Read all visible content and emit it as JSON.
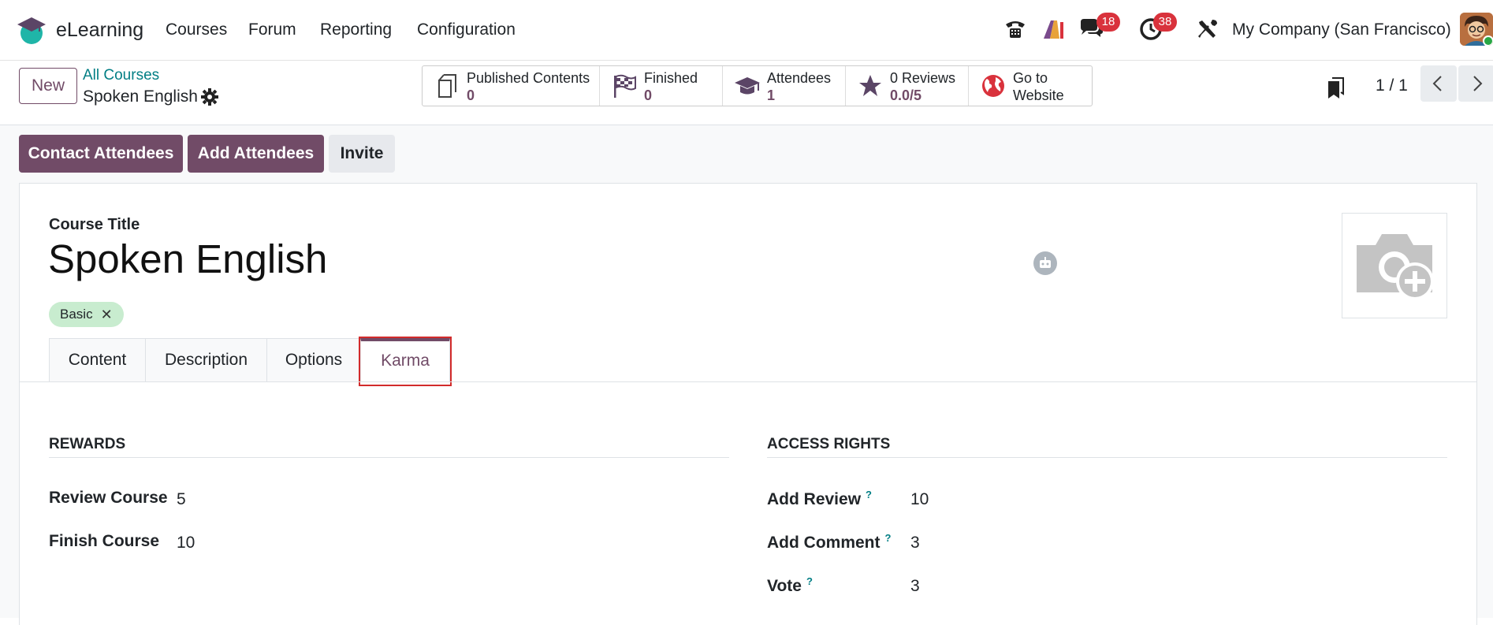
{
  "nav": {
    "app_name": "eLearning",
    "menu": [
      "Courses",
      "Forum",
      "Reporting",
      "Configuration"
    ],
    "badges": {
      "messages": "18",
      "activities": "38"
    },
    "company": "My Company (San Francisco)"
  },
  "control": {
    "new_label": "New",
    "breadcrumb": "All Courses",
    "record_name": "Spoken English",
    "stats": [
      {
        "line1": "Published Contents",
        "line2": "0",
        "icon": "copy-documents-icon"
      },
      {
        "line1": "Finished",
        "line2": "0",
        "icon": "finish-flag-icon"
      },
      {
        "line1": "Attendees",
        "line2": "1",
        "icon": "graduation-cap-icon"
      },
      {
        "line1": "0 Reviews",
        "line2": "0.0/5",
        "icon": "star-icon"
      },
      {
        "line1": "Go to",
        "line2": "Website",
        "icon": "globe-icon"
      }
    ],
    "pager": "1 / 1"
  },
  "actions": {
    "contact": "Contact Attendees",
    "add": "Add Attendees",
    "invite": "Invite"
  },
  "form": {
    "title_label": "Course Title",
    "title": "Spoken English",
    "tag": "Basic",
    "tabs": [
      "Content",
      "Description",
      "Options",
      "Karma"
    ],
    "active_tab": "Karma"
  },
  "karma": {
    "rewards_title": "REWARDS",
    "rewards": [
      {
        "label": "Review Course",
        "value": "5"
      },
      {
        "label": "Finish Course",
        "value": "10"
      }
    ],
    "access_title": "ACCESS RIGHTS",
    "access": [
      {
        "label": "Add Review",
        "value": "10",
        "help": "?"
      },
      {
        "label": "Add Comment",
        "value": "3",
        "help": "?"
      },
      {
        "label": "Vote",
        "value": "3",
        "help": "?"
      }
    ]
  },
  "colors": {
    "brand": "#714b67",
    "link": "#017e84",
    "tag_bg": "#c8eccf",
    "badge": "#d9323c",
    "highlight": "#d22b2b"
  }
}
